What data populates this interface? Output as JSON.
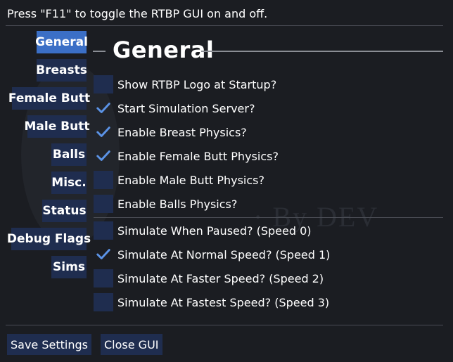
{
  "hint": "Press \"F11\" to toggle the RTBP GUI on and off.",
  "nav": {
    "items": [
      {
        "label": "General"
      },
      {
        "label": "Breasts"
      },
      {
        "label": "Female Butt"
      },
      {
        "label": "Male Butt"
      },
      {
        "label": "Balls"
      },
      {
        "label": "Misc."
      },
      {
        "label": "Status"
      },
      {
        "label": "Debug Flags"
      },
      {
        "label": "Sims"
      }
    ],
    "active": "General"
  },
  "section": {
    "title": "General"
  },
  "options": [
    {
      "label": "Show RTBP Logo at Startup?",
      "checked": false
    },
    {
      "label": "Start Simulation Server?",
      "checked": true
    },
    {
      "label": "Enable Breast Physics?",
      "checked": true
    },
    {
      "label": "Enable Female Butt Physics?",
      "checked": true
    },
    {
      "label": "Enable Male Butt Physics?",
      "checked": false
    },
    {
      "label": "Enable Balls Physics?",
      "checked": false
    },
    {
      "label": "Simulate When Paused? (Speed 0)",
      "checked": false
    },
    {
      "label": "Simulate At Normal Speed? (Speed 1)",
      "checked": true
    },
    {
      "label": "Simulate At Faster Speed? (Speed 2)",
      "checked": false
    },
    {
      "label": "Simulate At Fastest Speed? (Speed 3)",
      "checked": false
    }
  ],
  "footer": {
    "save_label": "Save Settings",
    "close_label": "Close GUI"
  },
  "colors": {
    "accent": "#3b6fc6",
    "button": "#1f2d4f",
    "check": "#5b93e6",
    "background": "#1b1d22"
  }
}
